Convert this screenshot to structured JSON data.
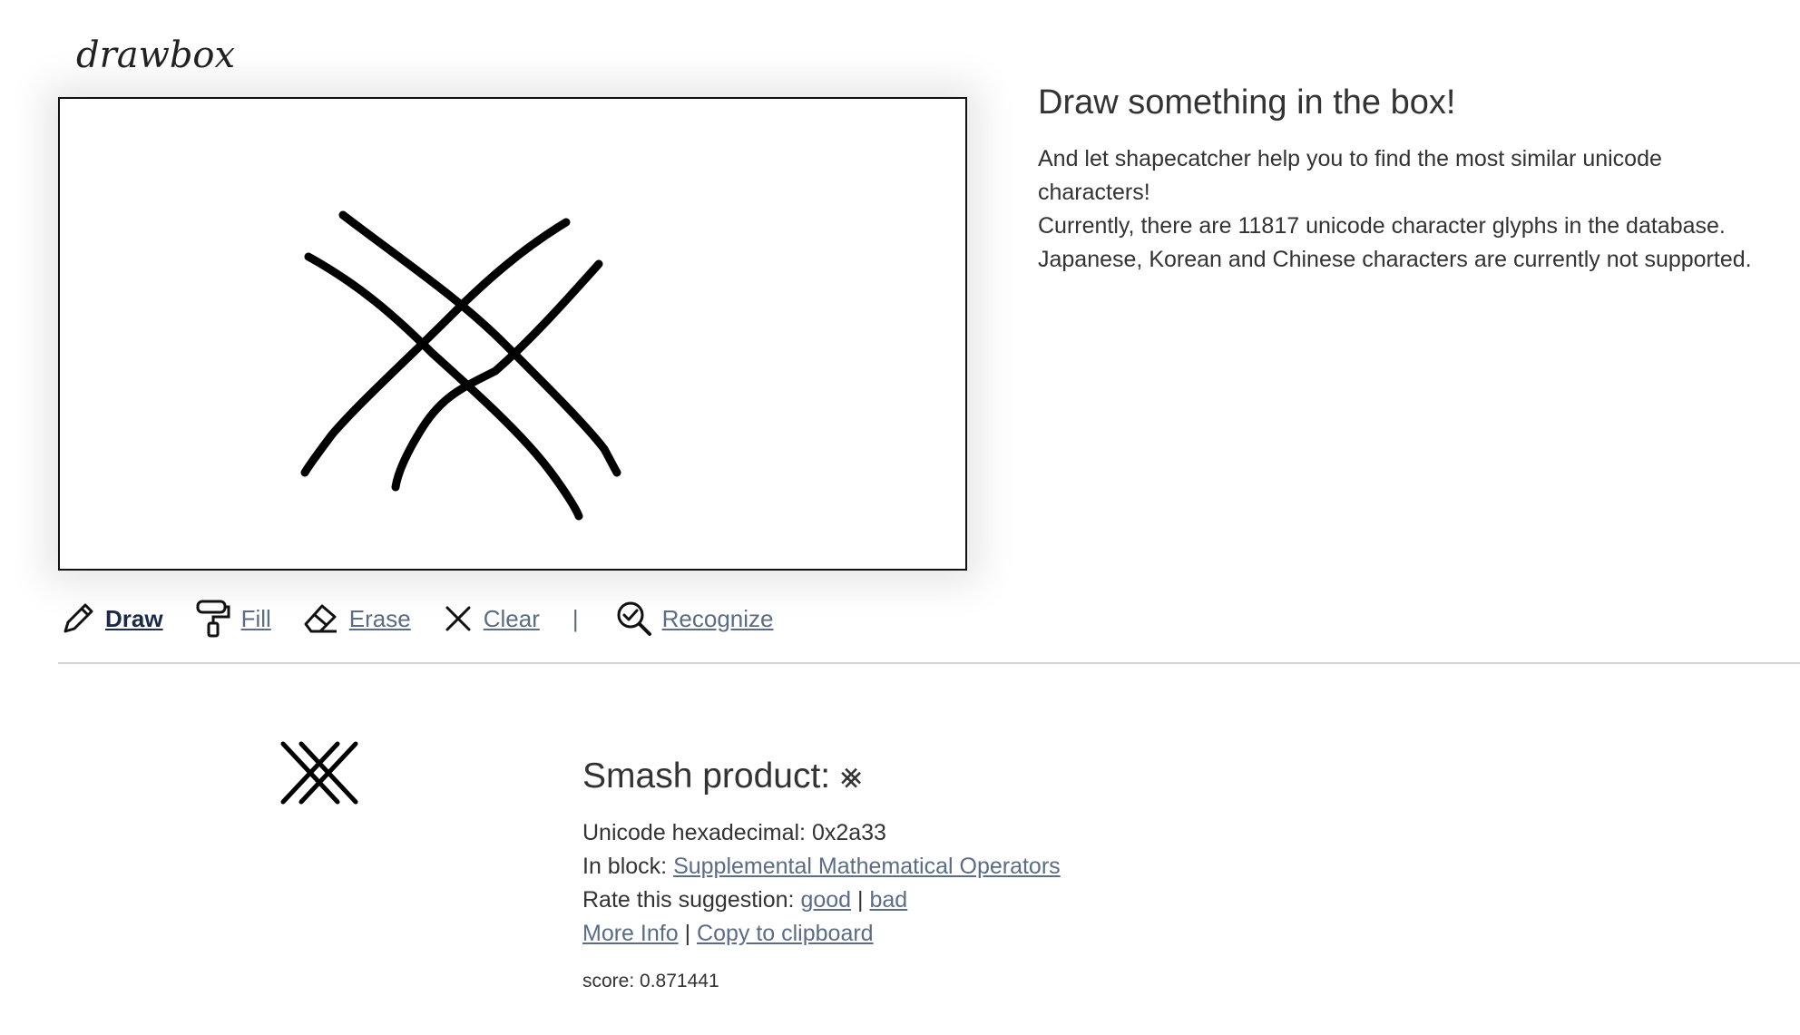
{
  "logo": {
    "text": "drawbox"
  },
  "intro": {
    "title": "Draw something in the box!",
    "line1": "And let shapecatcher help you to find the most similar unicode characters!",
    "line2": "Currently, there are 11817 unicode character glyphs in the database.",
    "line3": "Japanese, Korean and Chinese characters are currently not supported."
  },
  "toolbar": {
    "draw_label": "Draw",
    "fill_label": "Fill",
    "erase_label": "Erase",
    "clear_label": "Clear",
    "separator": "|",
    "recognize_label": "Recognize",
    "active_tool": "draw"
  },
  "icons": {
    "draw": "pencil-icon",
    "fill": "paint-roller-icon",
    "erase": "eraser-icon",
    "clear": "x-icon",
    "recognize": "magnify-check-icon"
  },
  "result": {
    "name": "Smash product:",
    "glyph": "⨳",
    "hex_label": "Unicode hexadecimal:",
    "hex_value": "0x2a33",
    "block_label": "In block:",
    "block_link": "Supplemental Mathematical Operators",
    "rate_label": "Rate this suggestion:",
    "rate_good": "good",
    "rate_sep": "|",
    "rate_bad": "bad",
    "more_info": "More Info",
    "links_sep": "|",
    "copy": "Copy to clipboard",
    "score_label": "score:",
    "score_value": "0.871441"
  },
  "colors": {
    "link": "#5a6c86",
    "active_link": "#1c2a4a",
    "text": "#333333",
    "stroke": "#111111"
  }
}
